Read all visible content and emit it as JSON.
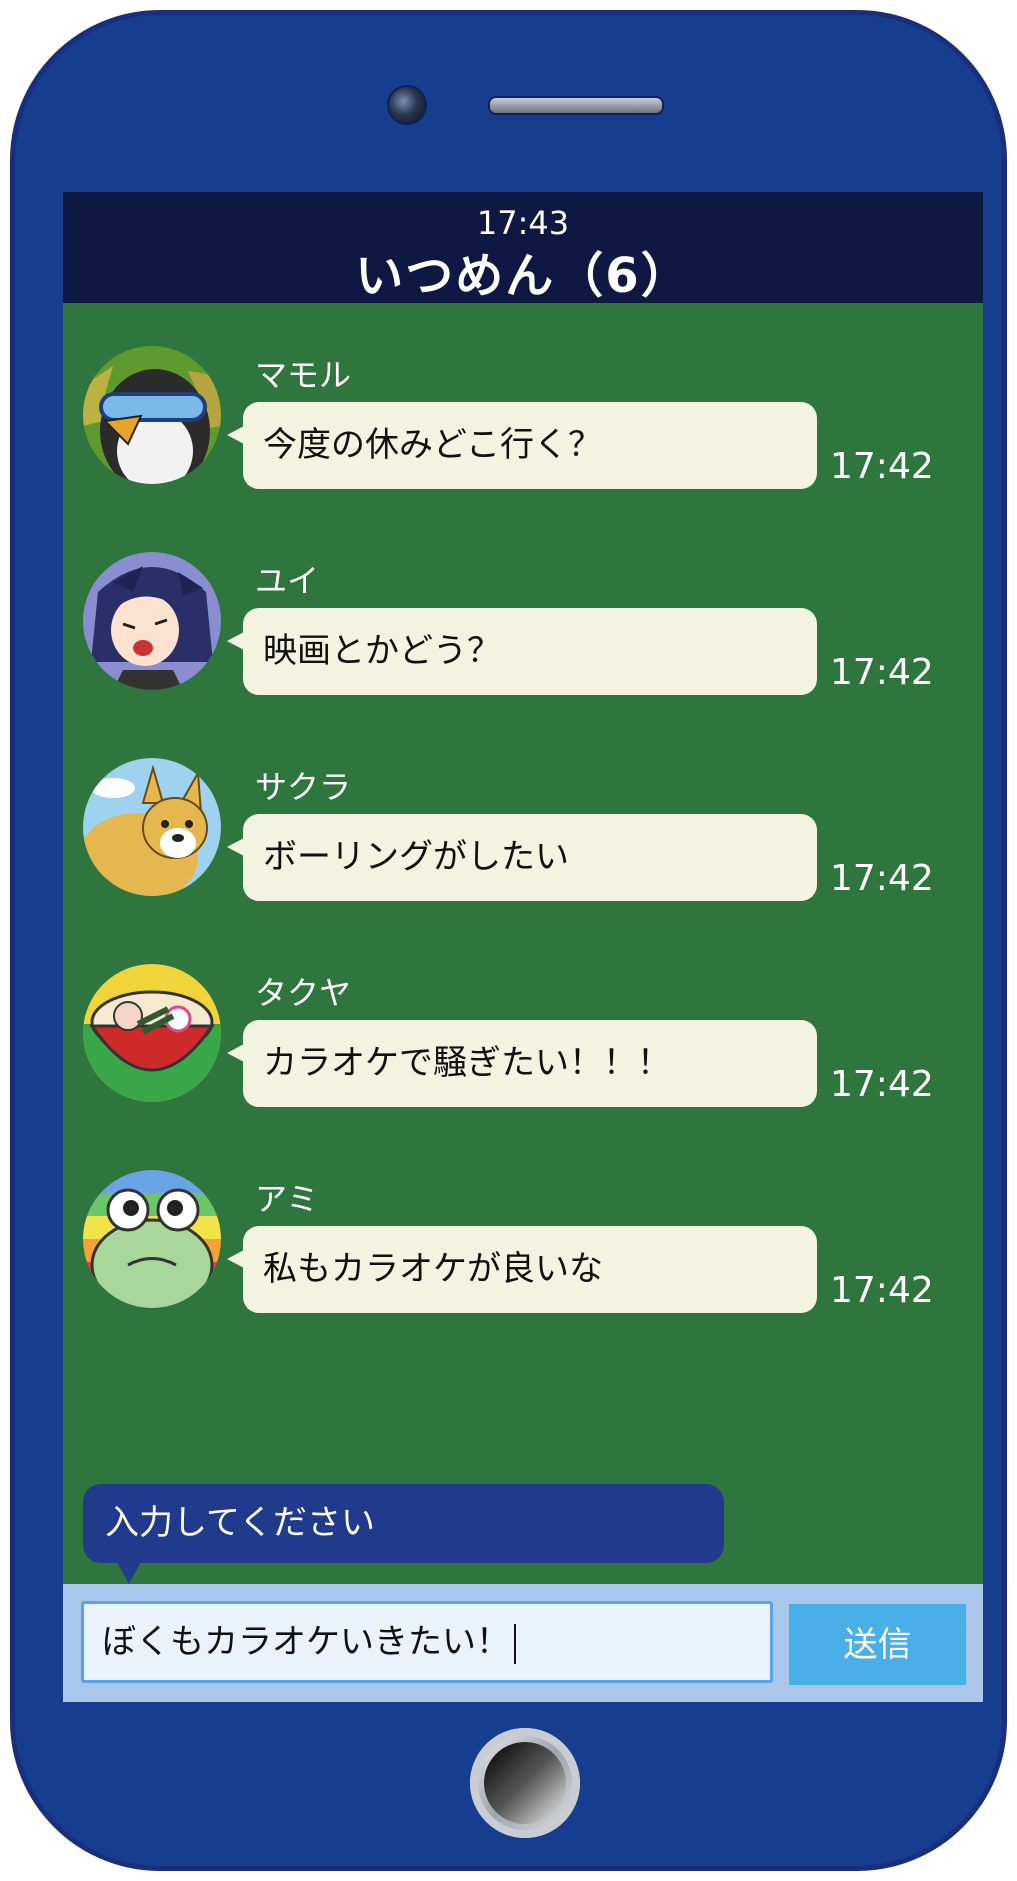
{
  "header": {
    "time": "17:43",
    "title": "いつめん（6）"
  },
  "messages": [
    {
      "sender": "マモル",
      "text": "今度の休みどこ行く？",
      "time": "17:42",
      "avatar": "penguin-avatar"
    },
    {
      "sender": "ユイ",
      "text": "映画とかどう？",
      "time": "17:42",
      "avatar": "girl-avatar"
    },
    {
      "sender": "サクラ",
      "text": "ボーリングがしたい",
      "time": "17:42",
      "avatar": "corgi-avatar"
    },
    {
      "sender": "タクヤ",
      "text": "カラオケで騒ぎたい！！！",
      "time": "17:42",
      "avatar": "ramen-avatar"
    },
    {
      "sender": "アミ",
      "text": "私もカラオケが良いな",
      "time": "17:42",
      "avatar": "frog-avatar"
    }
  ],
  "composer": {
    "prompt": "入力してください",
    "input_value": "ぼくもカラオケいきたい！",
    "send_label": "送信"
  },
  "colors": {
    "phone_body": "#163d8e",
    "chat_background": "#2e763e",
    "header_background": "#0f1843",
    "bubble": "#f2f4df",
    "send_button": "#4aaee8"
  }
}
